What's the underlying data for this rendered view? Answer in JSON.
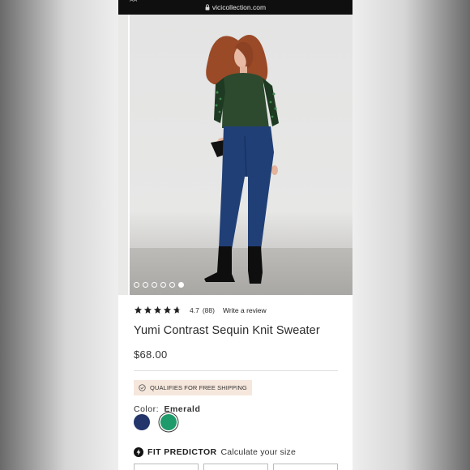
{
  "browser": {
    "url": "vicicollection.com",
    "back_text": "AA"
  },
  "gallery": {
    "image_count": 6,
    "active_index": 5
  },
  "product": {
    "rating": "4.7",
    "review_count": "(88)",
    "stars_filled": 4.7,
    "write_review": "Write a review",
    "title": "Yumi Contrast Sequin Knit Sweater",
    "price": "$68.00",
    "shipping_badge": "QUALIFIES FOR FREE SHIPPING",
    "color_label": "Color:",
    "color_value": "Emerald",
    "swatches": [
      {
        "name": "navy",
        "hex": "#23356b"
      },
      {
        "name": "emerald",
        "hex": "#1f9a6b",
        "selected": true
      }
    ]
  },
  "fit_predictor": {
    "title": "FIT PREDICTOR",
    "subtitle": "Calculate your size"
  },
  "colors": {
    "urlbar": "#0f0f0f",
    "badge_bg": "#f6e7dc",
    "text": "#2b2b2b"
  }
}
